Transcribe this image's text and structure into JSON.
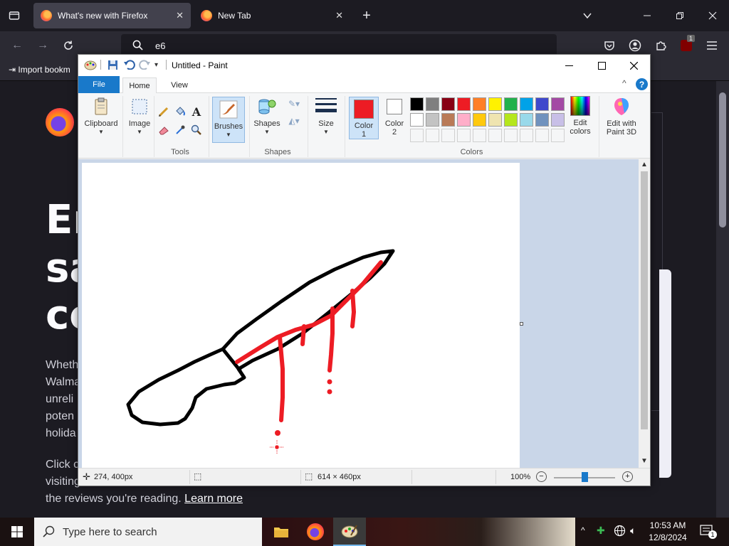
{
  "firefox": {
    "tabs": [
      {
        "title": "What's new with Firefox",
        "active": true
      },
      {
        "title": "New Tab",
        "active": false
      }
    ],
    "url": "e6",
    "bookmark": "Import bookm",
    "page": {
      "heading_lines": [
        "En",
        "sa",
        "co"
      ],
      "para1": [
        "Wheth",
        "Walma",
        "unreli",
        "poten",
        "holida"
      ],
      "para2": [
        "Click c",
        "visiting"
      ],
      "para_last": "the reviews you're reading.",
      "learn_more": "Learn more"
    },
    "extension_badge": "1"
  },
  "paint": {
    "title": "Untitled - Paint",
    "tabs": {
      "file": "File",
      "home": "Home",
      "view": "View"
    },
    "ribbon": {
      "clipboard": "Clipboard",
      "image": "Image",
      "tools": "Tools",
      "brushes": "Brushes",
      "shapes_btn": "Shapes",
      "shapes_group": "Shapes",
      "size": "Size",
      "color1": [
        "Color",
        "1"
      ],
      "color2": [
        "Color",
        "2"
      ],
      "colors_group": "Colors",
      "edit_colors": [
        "Edit",
        "colors"
      ],
      "edit_paint3d": [
        "Edit with",
        "Paint 3D"
      ]
    },
    "colors": {
      "color1": "#ed1c24",
      "color2": "#ffffff",
      "palette_row1": [
        "#000000",
        "#7f7f7f",
        "#880015",
        "#ed1c24",
        "#ff7f27",
        "#fff200",
        "#22b14c",
        "#00a2e8",
        "#3f48cc",
        "#a349a4"
      ],
      "palette_row2": [
        "#ffffff",
        "#c3c3c3",
        "#b97a57",
        "#ffaec9",
        "#ffc90e",
        "#efe4b0",
        "#b5e61d",
        "#99d9ea",
        "#7092be",
        "#c8bfe7"
      ]
    },
    "status": {
      "cursor_pos": "274, 400px",
      "canvas_size": "614 × 460px",
      "zoom": "100%"
    }
  },
  "taskbar": {
    "search_placeholder": "Type here to search",
    "time": "10:53 AM",
    "date": "12/8/2024",
    "notification_count": "1"
  }
}
